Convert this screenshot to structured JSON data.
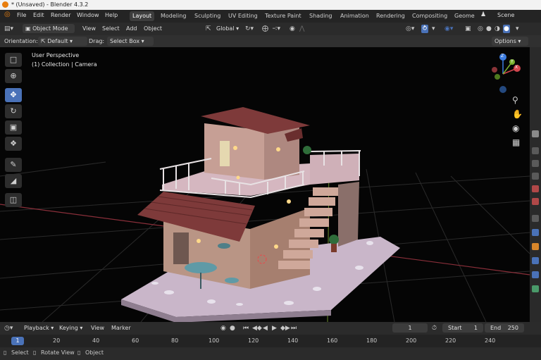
{
  "window": {
    "title": "* (Unsaved) - Blender 4.3.2"
  },
  "menu": {
    "items": [
      "File",
      "Edit",
      "Render",
      "Window",
      "Help"
    ]
  },
  "workspaces": {
    "tabs": [
      "Layout",
      "Modeling",
      "Sculpting",
      "UV Editing",
      "Texture Paint",
      "Shading",
      "Animation",
      "Rendering",
      "Compositing",
      "Geome"
    ],
    "active": "Layout"
  },
  "scene": {
    "label": "Scene"
  },
  "header": {
    "mode": "Object Mode",
    "view": "View",
    "select": "Select",
    "add": "Add",
    "object": "Object",
    "transform": "Global"
  },
  "tool_settings": {
    "orientation_label": "Orientation:",
    "orientation_value": "Default",
    "drag_label": "Drag:",
    "drag_value": "Select Box",
    "options": "Options"
  },
  "viewport": {
    "perspective": "User Perspective",
    "collection": "(1) Collection | Camera"
  },
  "gizmo": {
    "x": "X",
    "y": "Y",
    "z": "Z"
  },
  "timeline": {
    "playback": "Playback",
    "keying": "Keying",
    "view": "View",
    "marker": "Marker",
    "current_frame": "1",
    "start_label": "Start",
    "start_value": "1",
    "end_label": "End",
    "end_value": "250"
  },
  "ruler": {
    "current": "1",
    "ticks": [
      "20",
      "40",
      "60",
      "80",
      "100",
      "120",
      "140",
      "160",
      "180",
      "200",
      "220",
      "240"
    ]
  },
  "status": {
    "select": "Select",
    "rotate": "Rotate View",
    "object": "Object"
  },
  "colors": {
    "accent": "#4a72b8",
    "workspace_active": "#3d3d3d",
    "x_axis": "#d3464e",
    "y_axis": "#7bb02e",
    "z_axis": "#3c7ce0"
  }
}
